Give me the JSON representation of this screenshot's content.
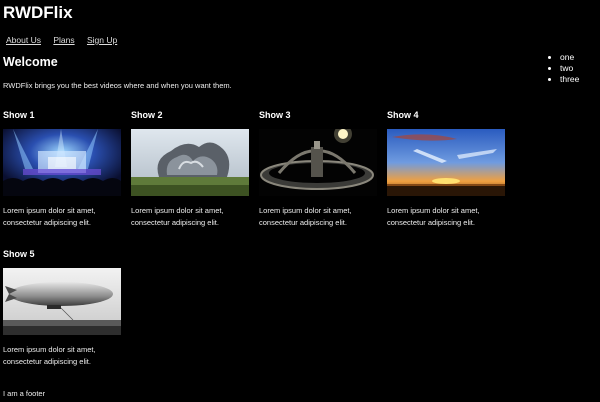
{
  "site": {
    "title": "RWDFlix"
  },
  "nav": {
    "items": [
      {
        "label": "About Us"
      },
      {
        "label": "Plans"
      },
      {
        "label": "Sign Up"
      }
    ]
  },
  "side_list": [
    "one",
    "two",
    "three"
  ],
  "main": {
    "heading": "Welcome",
    "intro": "RWDFlix brings you the best videos where and when you want them."
  },
  "shows": [
    {
      "title": "Show 1",
      "image": "concert-stage-image",
      "desc1": "Lorem ipsum dolor sit amet,",
      "desc2": "consectetur adipiscing elit."
    },
    {
      "title": "Show 2",
      "image": "metal-sculpture-image",
      "desc1": "Lorem ipsum dolor sit amet,",
      "desc2": "consectetur adipiscing elit."
    },
    {
      "title": "Show 3",
      "image": "space-station-ring-image",
      "desc1": "Lorem ipsum dolor sit amet,",
      "desc2": "consectetur adipiscing elit."
    },
    {
      "title": "Show 4",
      "image": "sunset-sky-image",
      "desc1": "Lorem ipsum dolor sit amet,",
      "desc2": "consectetur adipiscing elit."
    },
    {
      "title": "Show 5",
      "image": "airship-photo-image",
      "desc1": "Lorem ipsum dolor sit amet,",
      "desc2": "consectetur adipiscing elit."
    }
  ],
  "footer": {
    "text": "I am a footer"
  }
}
